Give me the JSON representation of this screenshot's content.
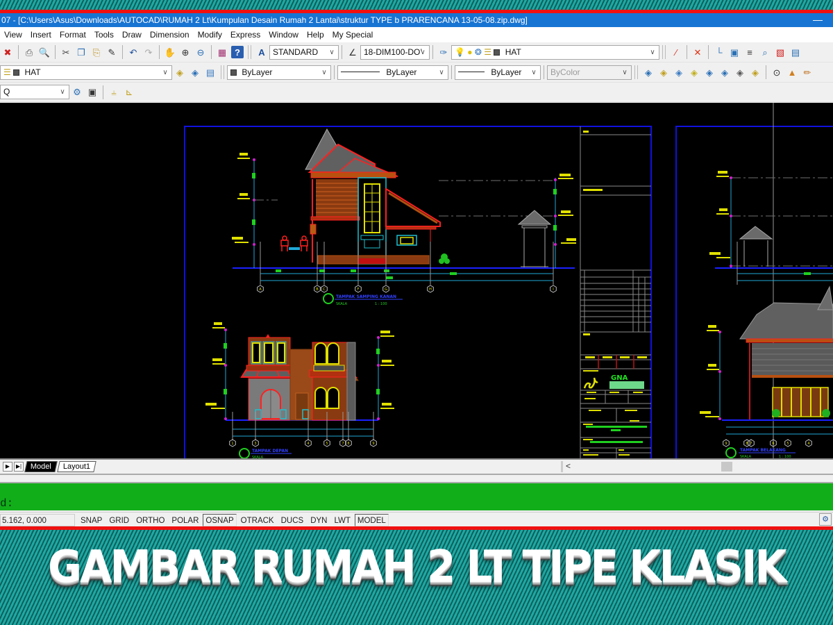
{
  "window": {
    "title": "07 - [C:\\Users\\Asus\\Downloads\\AUTOCAD\\RUMAH 2 Lt\\Kumpulan Desain Rumah 2 Lantai\\struktur TYPE b PRARENCANA 13-05-08.zip.dwg]",
    "minimize_label": "—"
  },
  "menu": [
    "View",
    "Insert",
    "Format",
    "Tools",
    "Draw",
    "Dimension",
    "Modify",
    "Express",
    "Window",
    "Help",
    "My Special"
  ],
  "toolbar": {
    "text_style": "STANDARD",
    "dim_style": "18-DIM100-DO’",
    "layer_current": "HAT",
    "layer_row2": "HAT",
    "color": "ByLayer",
    "linetype": "ByLayer",
    "lineweight": "ByLayer",
    "plotstyle": "ByColor",
    "workspace": "Q",
    "dropdown_arrow": "∨"
  },
  "icons": {
    "row1_left": [
      {
        "name": "close-icon",
        "glyph": "✖",
        "color": "#d02020"
      },
      {
        "name": "plot-icon",
        "glyph": "⎙",
        "color": "#555"
      },
      {
        "name": "plot-preview-icon",
        "glyph": "🔍",
        "color": "#2a6fb5"
      },
      {
        "name": "cut-icon",
        "glyph": "✂",
        "color": "#444"
      },
      {
        "name": "copy-icon",
        "glyph": "❐",
        "color": "#2a6fb5"
      },
      {
        "name": "paste-icon",
        "glyph": "⎘",
        "color": "#c09020"
      },
      {
        "name": "match-properties-icon",
        "glyph": "✎",
        "color": "#333"
      },
      {
        "name": "undo-icon",
        "glyph": "↶",
        "color": "#1c4f9c"
      },
      {
        "name": "redo-icon",
        "glyph": "↷",
        "color": "#aaa"
      },
      {
        "name": "pan-icon",
        "glyph": "✋",
        "color": "#b04a8a"
      },
      {
        "name": "zoom-realtime-icon",
        "glyph": "⊕",
        "color": "#333"
      },
      {
        "name": "zoom-window-icon",
        "glyph": "⊖",
        "color": "#2a6fb5"
      },
      {
        "name": "tool-palettes-icon",
        "glyph": "▦",
        "color": "#a03070"
      },
      {
        "name": "help-icon",
        "glyph": "?",
        "color": "#fff"
      }
    ],
    "row1_right": [
      {
        "name": "line-icon",
        "glyph": "∕",
        "color": "#d03020"
      },
      {
        "name": "erase-icon",
        "glyph": "✕",
        "color": "#e03010"
      },
      {
        "name": "ucs-icon",
        "glyph": "└",
        "color": "#2a6fb5"
      },
      {
        "name": "block-icon",
        "glyph": "▣",
        "color": "#2a6fb5"
      },
      {
        "name": "text-abc-icon",
        "glyph": "≡",
        "color": "#333"
      },
      {
        "name": "find-icon",
        "glyph": "⌕",
        "color": "#2a6fb5"
      },
      {
        "name": "render-icon",
        "glyph": "▧",
        "color": "#d02020"
      },
      {
        "name": "properties-icon",
        "glyph": "▤",
        "color": "#2a6fb5"
      }
    ],
    "row2_right": [
      {
        "name": "layer-isolate-icon",
        "glyph": "◈",
        "color": "#2a6fb5"
      },
      {
        "name": "layer-on-icon",
        "glyph": "◈",
        "color": "#c0a020"
      },
      {
        "name": "layer-freeze-icon",
        "glyph": "◈",
        "color": "#3a7ac0"
      },
      {
        "name": "layer-thaw-icon",
        "glyph": "◈",
        "color": "#c0b020"
      },
      {
        "name": "layer-match-icon",
        "glyph": "◈",
        "color": "#2a6fb5"
      },
      {
        "name": "layer-merge-icon",
        "glyph": "◈",
        "color": "#2a6fb5"
      },
      {
        "name": "layer-lock-icon",
        "glyph": "◈",
        "color": "#555"
      },
      {
        "name": "layer-unlock-icon",
        "glyph": "◈",
        "color": "#c0a020"
      },
      {
        "name": "zoom-extents-icon",
        "glyph": "⊙",
        "color": "#333"
      },
      {
        "name": "cleanup-icon",
        "glyph": "▲",
        "color": "#d08020"
      },
      {
        "name": "brush-icon",
        "glyph": "✏",
        "color": "#c07020"
      }
    ]
  },
  "drawing": {
    "sheet1_label_side": "TAMPAK SAMPING KANAN",
    "sheet1_label_front": "TAMPAK DEPAN",
    "sheet2_label": "TAMPAK BELAKANG",
    "scale_text": "SKALA",
    "scale_value": "1 : 100",
    "grid_side": [
      "A",
      "B",
      "C",
      "F",
      "G",
      "H",
      "I"
    ],
    "grid_front": [
      "1",
      "3",
      "4",
      "5",
      "7",
      "8",
      "9"
    ],
    "grid_back": [
      "9",
      "8",
      "7",
      "6",
      "5",
      "4"
    ],
    "logo_text": "GNA"
  },
  "tabs": {
    "first_label": "▶",
    "last_label": "▶|",
    "items": [
      {
        "label": "Model",
        "active": true
      },
      {
        "label": "Layout1",
        "active": false
      }
    ],
    "scroll_left": "<"
  },
  "command": {
    "prompt": "d:"
  },
  "status": {
    "coords": "5.162, 0.000",
    "toggles": [
      {
        "label": "SNAP",
        "on": false
      },
      {
        "label": "GRID",
        "on": false
      },
      {
        "label": "ORTHO",
        "on": false
      },
      {
        "label": "POLAR",
        "on": false
      },
      {
        "label": "OSNAP",
        "on": true
      },
      {
        "label": "OTRACK",
        "on": false
      },
      {
        "label": "DUCS",
        "on": false
      },
      {
        "label": "DYN",
        "on": false
      },
      {
        "label": "LWT",
        "on": false
      },
      {
        "label": "MODEL",
        "on": true
      }
    ],
    "tray_glyph": "⚙"
  },
  "banner": {
    "title": "GAMBAR RUMAH 2 LT TIPE KLASIK"
  },
  "colors": {
    "titlebar": "#1874d2",
    "command_bg": "#12ae1a",
    "banner_red": "#f01010",
    "banner_teal": "#1fa9a3",
    "sheet_border": "#1010e0"
  }
}
